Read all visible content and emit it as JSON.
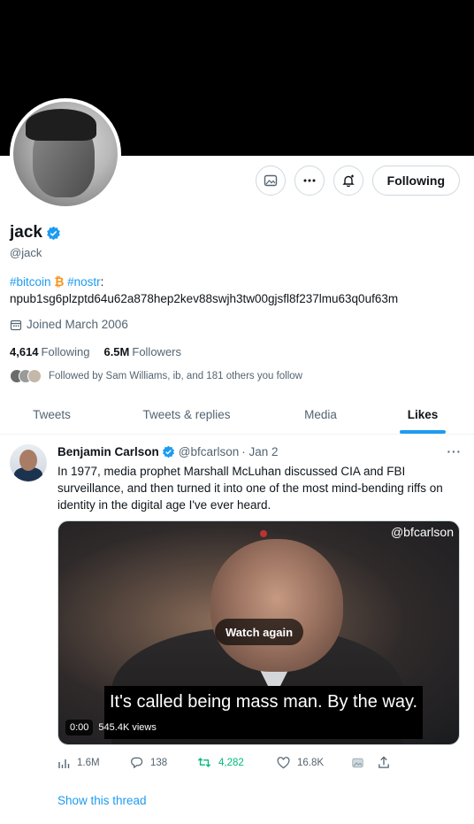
{
  "profile": {
    "name": "jack",
    "handle": "@jack",
    "bio_tag_bitcoin": "#bitcoin",
    "bio_tag_nostr": "#nostr",
    "bio_colon": ":",
    "bio_key": "npub1sg6plzptd64u62a878hep2kev88swjh3tw00gjsfl8f237lmu63q0uf63m",
    "joined": "Joined March 2006",
    "following_count": "4,614",
    "following_label": "Following",
    "followers_count": "6.5M",
    "followers_label": "Followers",
    "followed_by": "Followed by Sam Williams, ib, and 181 others you follow"
  },
  "actions": {
    "follow_label": "Following"
  },
  "tabs": [
    {
      "label": "Tweets",
      "active": false
    },
    {
      "label": "Tweets & replies",
      "active": false
    },
    {
      "label": "Media",
      "active": false
    },
    {
      "label": "Likes",
      "active": true
    }
  ],
  "tweet": {
    "author": "Benjamin Carlson",
    "handle": "@bfcarlson",
    "date": "· Jan 2",
    "more": "···",
    "text": "In 1977, media prophet Marshall McLuhan discussed CIA and FBI surveillance, and then turned it into one of the most mind-bending riffs on identity in the digital age I've ever heard.",
    "media": {
      "watermark": "@bfcarlson",
      "watch_again": "Watch again",
      "subtitle": "It's called being mass man. By the way.",
      "time": "0:00",
      "views": "545.4K views"
    },
    "stats": {
      "views": "1.6M",
      "replies": "138",
      "retweets": "4,282",
      "likes": "16.8K"
    },
    "show_thread": "Show this thread"
  },
  "colors": {
    "accent": "#1d9bf0",
    "retweet": "#00ba7c",
    "bitcoin": "#f7931a"
  }
}
